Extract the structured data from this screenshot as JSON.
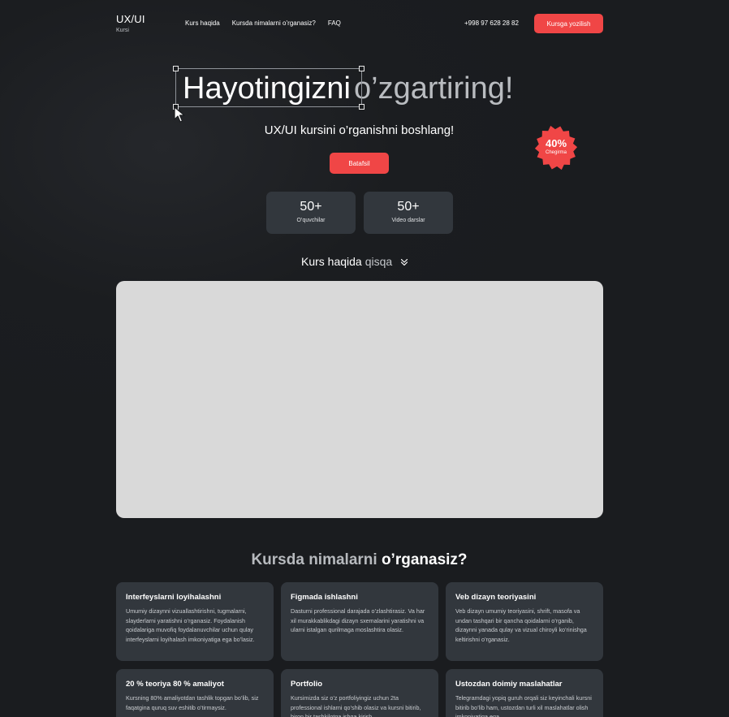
{
  "header": {
    "logo_main": "UX/UI",
    "logo_sub": "Kursi",
    "nav": [
      "Kurs haqida",
      "Kursda nimalarni o’rganasiz?",
      "FAQ"
    ],
    "phone": "+998 97 628 28 82",
    "enroll_label": "Kursga yozilish"
  },
  "hero": {
    "title_part1": "Hayotingizni",
    "title_part2": "o’zgartiring!",
    "subtitle": "UX/UI kursini o’rganishni boshlang!",
    "details_label": "Batafsil",
    "badge_percent": "40%",
    "badge_label": "Chegirma"
  },
  "stats": [
    {
      "value": "50+",
      "label": "O’quvchilar"
    },
    {
      "value": "50+",
      "label": "Video darslar"
    }
  ],
  "about": {
    "title": "Kurs haqida",
    "highlight": "qisqa"
  },
  "learn": {
    "title_part1": "Kursda nimalarni",
    "title_part2": "o’rganasiz?",
    "cards": [
      {
        "title": "Interfeyslarni loyihalashni",
        "text": "Umumiy dizaynni vizuallashtirishni, tugmalarni, slayderlarni yaratishni o’rganasiz. Foydalanish qoidalariga muvofiq foydalanuvchilar uchun qulay interfeyslarni loyihalash imkoniyatiga ega bo’lasiz."
      },
      {
        "title": "Figmada ishlashni",
        "text": "Dasturni professional darajada o’zlashtirasiz. Va har xil murakkablikdagi dizayn sxemalarini yaratishni va ularni istalgan qurilmaga moslashtira olasiz."
      },
      {
        "title": "Veb dizayn teoriyasini",
        "text": "Veb dizayn umumiy teoriyasini, shrift, masofa va undan tashqari bir qancha qoidalarni o’rganib, dizaynni yanada qulay va vizual chiroyli ko’rinishga keltirishni o’rganasiz."
      },
      {
        "title": "20 % teoriya 80 % amaliyot",
        "text": "Kursning 80% amaliyotdan tashlik topgan bo’lib, siz faqatgina quruq suv eshitib o’tirmaysiz."
      },
      {
        "title": "Portfolio",
        "text": "Kursimizda siz o’z portfoliyingiz uchun 2ta professional ishlarni qo’shib olasiz va kursni bitirib, biron bir tashkilotga ishga kirish"
      },
      {
        "title": "Ustozdan doimiy maslahatlar",
        "text": "Telegramdagi yopiq guruh orqali siz keyinchali kursni bitirib bo’lib ham, ustozdan turli xil maslahatlar olish imkoniyatiga ega"
      }
    ]
  },
  "colors": {
    "accent": "#f04646",
    "background": "#1a1c1f",
    "card": "#32373d",
    "video_placeholder": "#d9d9d9"
  },
  "icons": {
    "cursor": "cursor-arrow-icon",
    "chevron": "double-chevron-down-icon",
    "badge": "discount-starburst-icon"
  }
}
